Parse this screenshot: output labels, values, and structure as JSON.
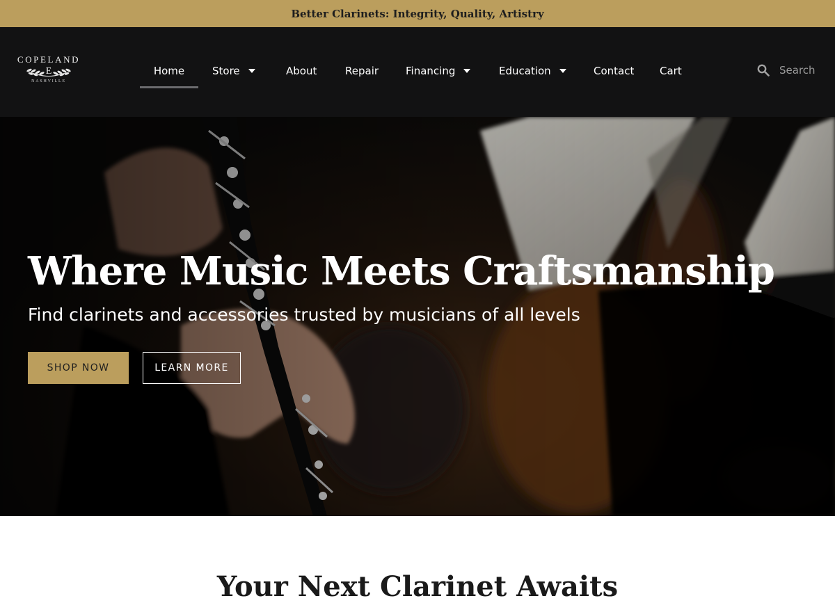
{
  "announcement": {
    "text": "Better Clarinets: Integrity, Quality, Artistry"
  },
  "brand": {
    "name": "COPELAND",
    "monogram": "E",
    "city": "NASHVILLE"
  },
  "nav": {
    "items": [
      {
        "label": "Home",
        "active": true,
        "dropdown": false
      },
      {
        "label": "Store",
        "active": false,
        "dropdown": true
      },
      {
        "label": "About",
        "active": false,
        "dropdown": false
      },
      {
        "label": "Repair",
        "active": false,
        "dropdown": false
      },
      {
        "label": "Financing",
        "active": false,
        "dropdown": true
      },
      {
        "label": "Education",
        "active": false,
        "dropdown": true
      },
      {
        "label": "Contact",
        "active": false,
        "dropdown": false
      },
      {
        "label": "Cart",
        "active": false,
        "dropdown": false
      }
    ]
  },
  "search": {
    "placeholder": "Search",
    "icon": "search-icon"
  },
  "hero": {
    "title": "Where Music Meets Craftsmanship",
    "subtitle": "Find clarinets and accessories trusted by musicians of all levels",
    "primary_button": "SHOP NOW",
    "secondary_button": "LEARN MORE"
  },
  "section": {
    "title": "Your Next Clarinet Awaits"
  },
  "colors": {
    "accent_gold": "#bb9e5d",
    "header_bg": "#121213",
    "text_light": "#ffffff",
    "text_dark": "#1a1a1a"
  }
}
